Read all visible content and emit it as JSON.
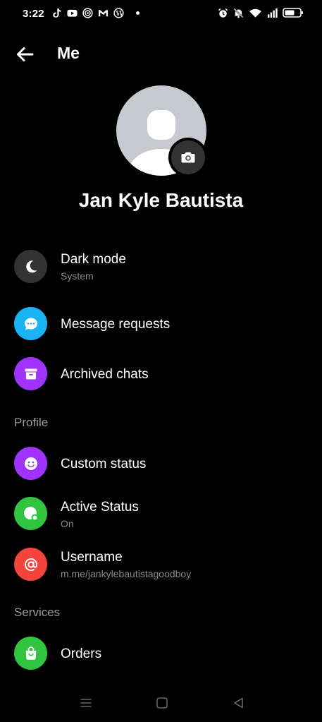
{
  "status_bar": {
    "time": "3:22",
    "left_icons": [
      "tiktok-icon",
      "youtube-icon",
      "target-icon",
      "gmail-icon",
      "wordpress-icon"
    ],
    "right_icons": [
      "alarm-icon",
      "mute-icon",
      "wifi-icon",
      "signal-icon",
      "battery-icon"
    ]
  },
  "header": {
    "title": "Me"
  },
  "profile": {
    "name": "Jan Kyle Bautista"
  },
  "menu": {
    "dark_mode": {
      "label": "Dark mode",
      "sub": "System"
    },
    "message_requests": {
      "label": "Message requests"
    },
    "archived_chats": {
      "label": "Archived chats"
    }
  },
  "sections": {
    "profile": {
      "title": "Profile",
      "custom_status": {
        "label": "Custom status"
      },
      "active_status": {
        "label": "Active Status",
        "sub": "On"
      },
      "username": {
        "label": "Username",
        "sub": "m.me/jankylebautistagoodboy"
      }
    },
    "services": {
      "title": "Services",
      "orders": {
        "label": "Orders"
      }
    }
  },
  "colors": {
    "background": "#000000",
    "dark_mode_icon_bg": "#333333",
    "message_requests_icon_bg": "#1ab4f5",
    "archived_chats_icon_bg": "#a033ff",
    "custom_status_icon_bg": "#a033ff",
    "active_status_icon_bg": "#31c440",
    "username_icon_bg": "#f5443c",
    "orders_icon_bg": "#31c440",
    "secondary_text": "#8a8a8a"
  }
}
